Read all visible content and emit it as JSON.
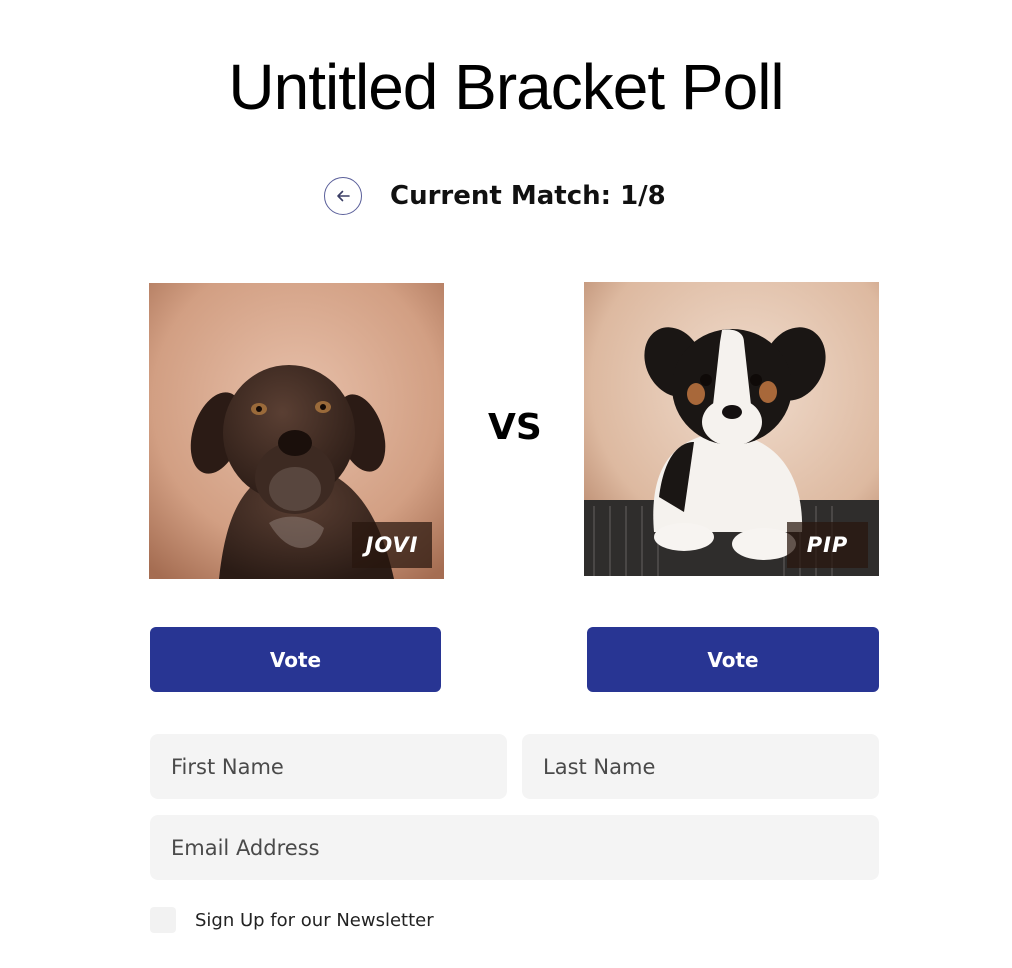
{
  "poll": {
    "title": "Untitled Bracket Poll"
  },
  "match": {
    "label": "Current Match: 1/8",
    "back_icon": "arrow-left-icon"
  },
  "contestants": [
    {
      "name": "JOVI",
      "vote_label": "Vote"
    },
    {
      "name": "PIP",
      "vote_label": "Vote"
    }
  ],
  "vs_label": "VS",
  "form": {
    "first_name_placeholder": "First Name",
    "first_name_value": "",
    "last_name_placeholder": "Last Name",
    "last_name_value": "",
    "email_placeholder": "Email Address",
    "email_value": "",
    "newsletter_label": "Sign Up for our Newsletter",
    "newsletter_checked": false
  },
  "colors": {
    "accent": "#283593",
    "field_bg": "#f4f4f4",
    "photo_bg_warm": "#d9a98e"
  }
}
